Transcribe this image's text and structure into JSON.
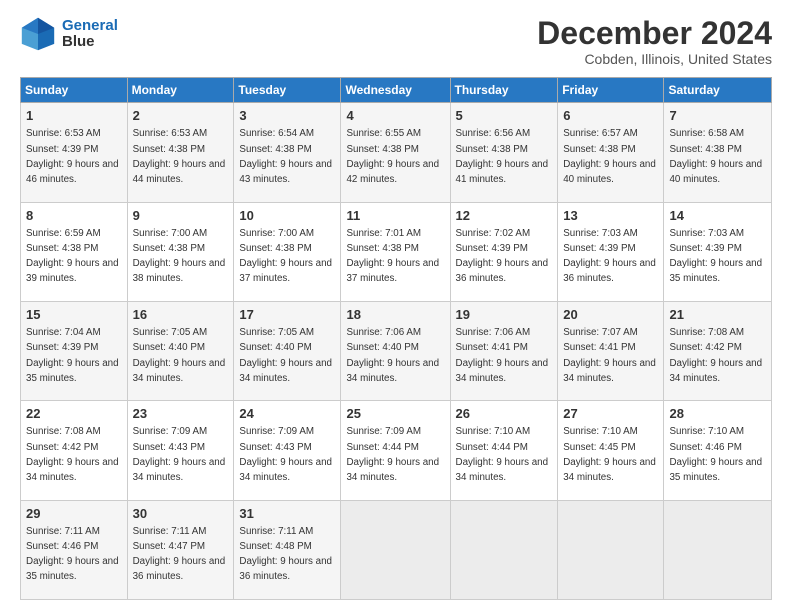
{
  "header": {
    "logo_line1": "General",
    "logo_line2": "Blue",
    "title": "December 2024",
    "subtitle": "Cobden, Illinois, United States"
  },
  "calendar": {
    "days_of_week": [
      "Sunday",
      "Monday",
      "Tuesday",
      "Wednesday",
      "Thursday",
      "Friday",
      "Saturday"
    ],
    "weeks": [
      [
        {
          "day": "1",
          "sunrise": "6:53 AM",
          "sunset": "4:39 PM",
          "daylight": "9 hours and 46 minutes."
        },
        {
          "day": "2",
          "sunrise": "6:53 AM",
          "sunset": "4:38 PM",
          "daylight": "9 hours and 44 minutes."
        },
        {
          "day": "3",
          "sunrise": "6:54 AM",
          "sunset": "4:38 PM",
          "daylight": "9 hours and 43 minutes."
        },
        {
          "day": "4",
          "sunrise": "6:55 AM",
          "sunset": "4:38 PM",
          "daylight": "9 hours and 42 minutes."
        },
        {
          "day": "5",
          "sunrise": "6:56 AM",
          "sunset": "4:38 PM",
          "daylight": "9 hours and 41 minutes."
        },
        {
          "day": "6",
          "sunrise": "6:57 AM",
          "sunset": "4:38 PM",
          "daylight": "9 hours and 40 minutes."
        },
        {
          "day": "7",
          "sunrise": "6:58 AM",
          "sunset": "4:38 PM",
          "daylight": "9 hours and 40 minutes."
        }
      ],
      [
        {
          "day": "8",
          "sunrise": "6:59 AM",
          "sunset": "4:38 PM",
          "daylight": "9 hours and 39 minutes."
        },
        {
          "day": "9",
          "sunrise": "7:00 AM",
          "sunset": "4:38 PM",
          "daylight": "9 hours and 38 minutes."
        },
        {
          "day": "10",
          "sunrise": "7:00 AM",
          "sunset": "4:38 PM",
          "daylight": "9 hours and 37 minutes."
        },
        {
          "day": "11",
          "sunrise": "7:01 AM",
          "sunset": "4:38 PM",
          "daylight": "9 hours and 37 minutes."
        },
        {
          "day": "12",
          "sunrise": "7:02 AM",
          "sunset": "4:39 PM",
          "daylight": "9 hours and 36 minutes."
        },
        {
          "day": "13",
          "sunrise": "7:03 AM",
          "sunset": "4:39 PM",
          "daylight": "9 hours and 36 minutes."
        },
        {
          "day": "14",
          "sunrise": "7:03 AM",
          "sunset": "4:39 PM",
          "daylight": "9 hours and 35 minutes."
        }
      ],
      [
        {
          "day": "15",
          "sunrise": "7:04 AM",
          "sunset": "4:39 PM",
          "daylight": "9 hours and 35 minutes."
        },
        {
          "day": "16",
          "sunrise": "7:05 AM",
          "sunset": "4:40 PM",
          "daylight": "9 hours and 34 minutes."
        },
        {
          "day": "17",
          "sunrise": "7:05 AM",
          "sunset": "4:40 PM",
          "daylight": "9 hours and 34 minutes."
        },
        {
          "day": "18",
          "sunrise": "7:06 AM",
          "sunset": "4:40 PM",
          "daylight": "9 hours and 34 minutes."
        },
        {
          "day": "19",
          "sunrise": "7:06 AM",
          "sunset": "4:41 PM",
          "daylight": "9 hours and 34 minutes."
        },
        {
          "day": "20",
          "sunrise": "7:07 AM",
          "sunset": "4:41 PM",
          "daylight": "9 hours and 34 minutes."
        },
        {
          "day": "21",
          "sunrise": "7:08 AM",
          "sunset": "4:42 PM",
          "daylight": "9 hours and 34 minutes."
        }
      ],
      [
        {
          "day": "22",
          "sunrise": "7:08 AM",
          "sunset": "4:42 PM",
          "daylight": "9 hours and 34 minutes."
        },
        {
          "day": "23",
          "sunrise": "7:09 AM",
          "sunset": "4:43 PM",
          "daylight": "9 hours and 34 minutes."
        },
        {
          "day": "24",
          "sunrise": "7:09 AM",
          "sunset": "4:43 PM",
          "daylight": "9 hours and 34 minutes."
        },
        {
          "day": "25",
          "sunrise": "7:09 AM",
          "sunset": "4:44 PM",
          "daylight": "9 hours and 34 minutes."
        },
        {
          "day": "26",
          "sunrise": "7:10 AM",
          "sunset": "4:44 PM",
          "daylight": "9 hours and 34 minutes."
        },
        {
          "day": "27",
          "sunrise": "7:10 AM",
          "sunset": "4:45 PM",
          "daylight": "9 hours and 34 minutes."
        },
        {
          "day": "28",
          "sunrise": "7:10 AM",
          "sunset": "4:46 PM",
          "daylight": "9 hours and 35 minutes."
        }
      ],
      [
        {
          "day": "29",
          "sunrise": "7:11 AM",
          "sunset": "4:46 PM",
          "daylight": "9 hours and 35 minutes."
        },
        {
          "day": "30",
          "sunrise": "7:11 AM",
          "sunset": "4:47 PM",
          "daylight": "9 hours and 36 minutes."
        },
        {
          "day": "31",
          "sunrise": "7:11 AM",
          "sunset": "4:48 PM",
          "daylight": "9 hours and 36 minutes."
        },
        {
          "day": "",
          "sunrise": "",
          "sunset": "",
          "daylight": ""
        },
        {
          "day": "",
          "sunrise": "",
          "sunset": "",
          "daylight": ""
        },
        {
          "day": "",
          "sunrise": "",
          "sunset": "",
          "daylight": ""
        },
        {
          "day": "",
          "sunrise": "",
          "sunset": "",
          "daylight": ""
        }
      ]
    ]
  }
}
